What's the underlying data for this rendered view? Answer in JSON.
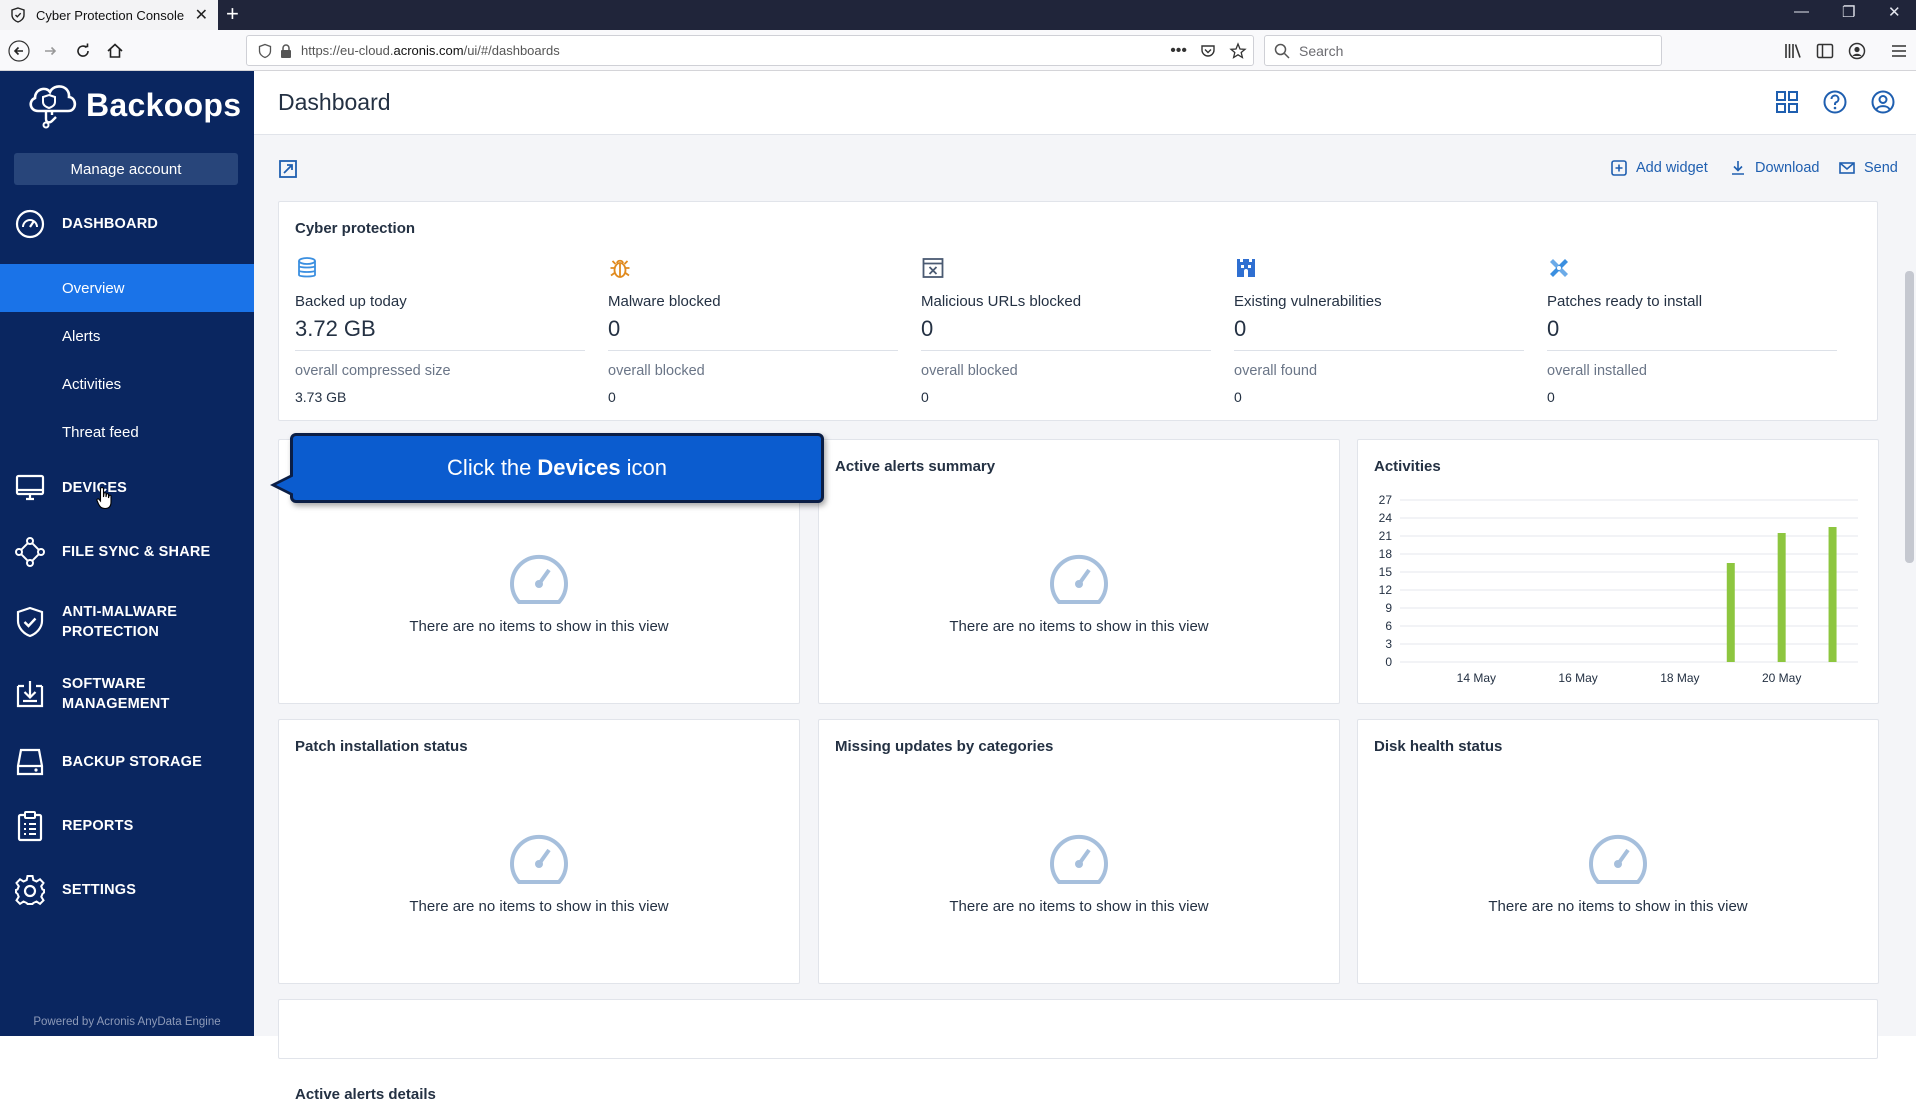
{
  "browser": {
    "tab_title": "Cyber Protection Console",
    "url_prefix": "https://eu-cloud.",
    "url_domain": "acronis.com",
    "url_path": "/ui/#/dashboards",
    "search_placeholder": "Search"
  },
  "sidebar": {
    "brand": "Backoops",
    "manage_account": "Manage account",
    "dashboard_label": "DASHBOARD",
    "sub_items": [
      {
        "label": "Overview"
      },
      {
        "label": "Alerts"
      },
      {
        "label": "Activities"
      },
      {
        "label": "Threat feed"
      }
    ],
    "sections": [
      {
        "label": "DEVICES",
        "icon": "monitor-icon"
      },
      {
        "label": "FILE SYNC & SHARE",
        "icon": "share-network-icon"
      },
      {
        "label": "ANTI-MALWARE PROTECTION",
        "icon": "shield-check-icon"
      },
      {
        "label": "SOFTWARE MANAGEMENT",
        "icon": "software-download-icon"
      },
      {
        "label": "BACKUP STORAGE",
        "icon": "storage-drive-icon"
      },
      {
        "label": "REPORTS",
        "icon": "clipboard-report-icon"
      },
      {
        "label": "SETTINGS",
        "icon": "gear-icon"
      }
    ],
    "powered_by": "Powered by Acronis AnyData Engine"
  },
  "header": {
    "title": "Dashboard"
  },
  "toolbar": {
    "add_widget": "Add widget",
    "download": "Download",
    "send": "Send"
  },
  "cyber_protection": {
    "title": "Cyber protection",
    "stats": [
      {
        "label": "Backed up today",
        "value": "3.72 GB",
        "sub_label": "overall compressed size",
        "sub_value": "3.73 GB",
        "icon": "database-icon",
        "color": "#3b8fe0"
      },
      {
        "label": "Malware blocked",
        "value": "0",
        "sub_label": "overall blocked",
        "sub_value": "0",
        "icon": "bug-icon",
        "color": "#e08a1e"
      },
      {
        "label": "Malicious URLs blocked",
        "value": "0",
        "sub_label": "overall blocked",
        "sub_value": "0",
        "icon": "blocked-url-icon",
        "color": "#4a5a72"
      },
      {
        "label": "Existing vulnerabilities",
        "value": "0",
        "sub_label": "overall found",
        "sub_value": "0",
        "icon": "castle-icon",
        "color": "#2f6fd1"
      },
      {
        "label": "Patches ready to install",
        "value": "0",
        "sub_label": "overall installed",
        "sub_value": "0",
        "icon": "patch-icon",
        "color": "#3b8fe0"
      }
    ]
  },
  "widgets": {
    "empty_text": "There are no items to show in this view",
    "active_alerts_summary": "Active alerts summary",
    "activities": "Activities",
    "patch_installation_status": "Patch installation status",
    "missing_updates": "Missing updates by categories",
    "disk_health_status": "Disk health status",
    "active_alerts_details": "Active alerts details"
  },
  "callout": {
    "prefix": "Click the",
    "bold": "Devices",
    "suffix": "icon"
  },
  "chart_data": {
    "type": "bar",
    "title": "Activities",
    "x_tick_labels": [
      "14 May",
      "16 May",
      "18 May",
      "20 May"
    ],
    "y_ticks": [
      0,
      3,
      6,
      9,
      12,
      15,
      18,
      21,
      24,
      27
    ],
    "ylim": [
      0,
      27
    ],
    "categories": [
      "13 May",
      "14 May",
      "15 May",
      "16 May",
      "17 May",
      "18 May",
      "19 May",
      "20 May",
      "21 May"
    ],
    "values": [
      0,
      0,
      0,
      0,
      0,
      0,
      16.5,
      21.5,
      22.5
    ],
    "colors": {
      "bar": "#8dc63f",
      "grid": "#e4e7ec"
    },
    "grid": true
  }
}
